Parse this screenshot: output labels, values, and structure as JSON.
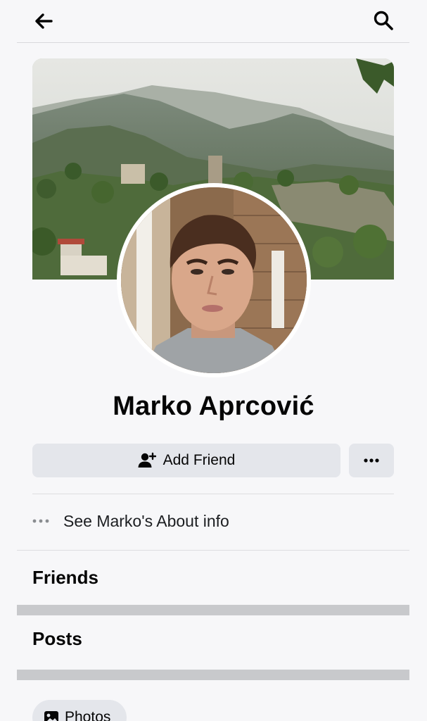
{
  "header": {
    "back_icon": "arrow-left-icon",
    "search_icon": "search-icon"
  },
  "profile": {
    "name": "Marko Aprcović",
    "cover_alt": "cover photo of a mountain village",
    "avatar_alt": "profile picture"
  },
  "actions": {
    "add_friend_label": "Add Friend",
    "add_friend_icon": "add-person-icon",
    "more_icon": "ellipsis-icon"
  },
  "about": {
    "label": "See Marko's About info"
  },
  "sections": {
    "friends_title": "Friends",
    "posts_title": "Posts"
  },
  "filters": {
    "photos_label": "Photos"
  },
  "colors": {
    "background": "#f7f7f9",
    "button_bg": "#e4e6eb",
    "separator": "#c8c9cc"
  }
}
